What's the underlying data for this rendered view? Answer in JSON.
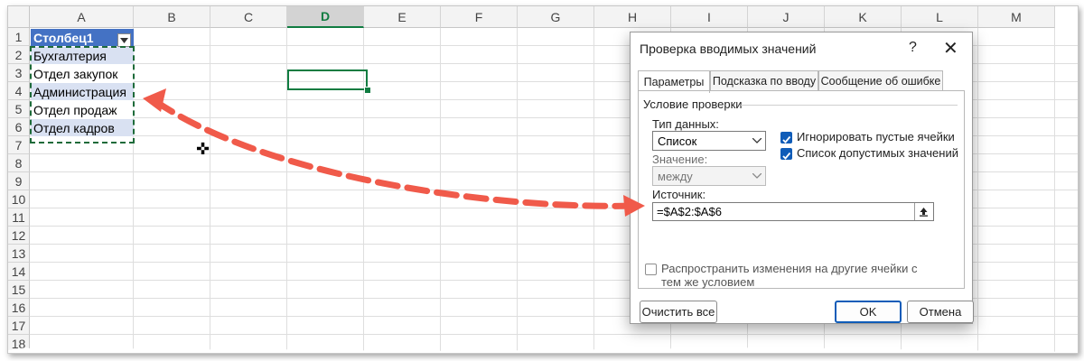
{
  "sheet": {
    "columns": [
      "A",
      "B",
      "C",
      "D",
      "E",
      "F",
      "G",
      "H",
      "I",
      "J",
      "K",
      "L",
      "M"
    ],
    "selected_column": "D",
    "rows": [
      "1",
      "2",
      "3",
      "4",
      "5",
      "6",
      "7",
      "8",
      "9",
      "10",
      "11",
      "12",
      "13",
      "14",
      "15",
      "16",
      "17",
      "18"
    ],
    "table_header": "Столбец1",
    "table_values": [
      "Бухгалтерия",
      "Отдел закупок",
      "Администрация",
      "Отдел продаж",
      "Отдел кадров"
    ],
    "header_color": "#4472c4",
    "band_color": "#d9e1f2"
  },
  "dialog": {
    "title": "Проверка вводимых значений",
    "help_label": "?",
    "close_label": "✕",
    "tabs": [
      "Параметры",
      "Подсказка по вводу",
      "Сообщение об ошибке"
    ],
    "active_tab": "Параметры",
    "group_label": "Условие проверки",
    "data_type_label": "Тип данных:",
    "data_type_value": "Список",
    "value_label": "Значение:",
    "value_value": "между",
    "ignore_blank_label": "Игнорировать пустые ячейки",
    "ignore_blank_checked": true,
    "in_cell_dropdown_label": "Список допустимых значений",
    "in_cell_dropdown_checked": true,
    "source_label": "Источник:",
    "source_value": "=$A$2:$A$6",
    "apply_all_label": "Распространить изменения на другие ячейки с тем же условием",
    "apply_all_checked": false,
    "clear_all_label": "Очистить все",
    "ok_label": "OK",
    "cancel_label": "Отмена",
    "accent_color": "#0f5cb8"
  },
  "annotation": {
    "arrow_color": "#f05a4a",
    "icon": "double-headed-dashed-arrow-icon"
  },
  "icons": {
    "filter": "filter-dropdown-icon",
    "cursor": "cell-cursor-icon",
    "collapse": "range-collapse-icon"
  }
}
